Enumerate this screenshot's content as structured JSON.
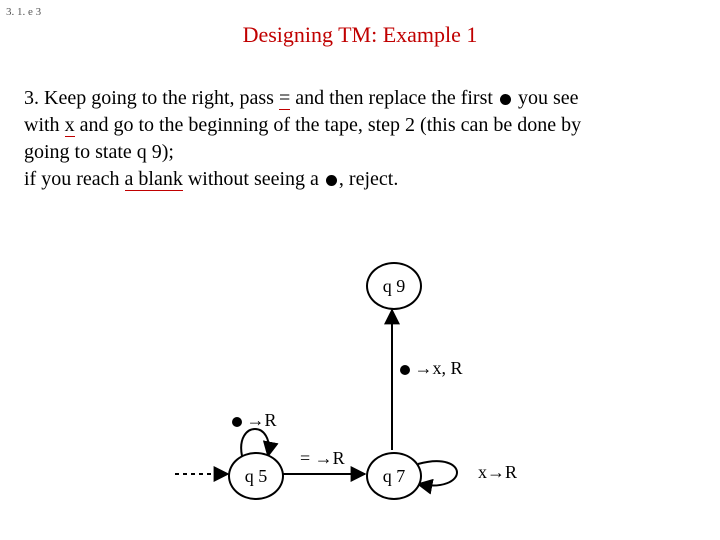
{
  "corner": "3. 1. e 3",
  "title": "Designing TM: Example 1",
  "para": {
    "l1a": "3. Keep going to the right, pass ",
    "l1b": "=",
    "l1c": " and then replace the first ",
    "l1d": " you see",
    "l2a": "with ",
    "l2b": "x",
    "l2c": " and go to the beginning of the tape,  step 2 (this can be done by",
    "l3": "going to state q 9);",
    "l4a": "if you reach ",
    "l4b": "a blank",
    "l4c": " without seeing a ",
    "l4d": ", reject."
  },
  "states": {
    "q9": "q 9",
    "q5": "q 5",
    "q7": "q 7"
  },
  "trans": {
    "q7q9": "→x, R",
    "q5loop": "→R",
    "q5q7": "= →R",
    "q7loop": "x→R"
  }
}
